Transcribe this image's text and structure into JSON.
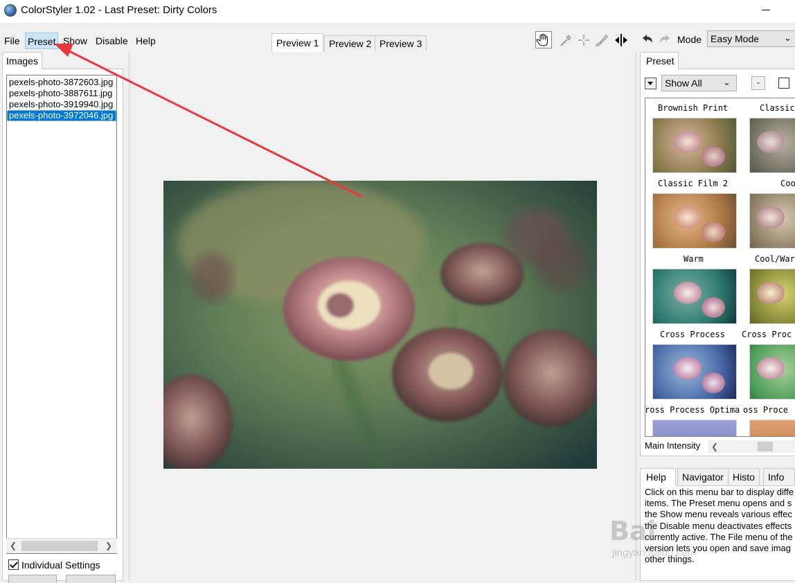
{
  "window": {
    "title": "ColorStyler 1.02 - Last Preset: Dirty Colors"
  },
  "menu": {
    "items": [
      "File",
      "Preset",
      "Show",
      "Disable",
      "Help"
    ]
  },
  "preview_tabs": [
    "Preview 1",
    "Preview 2",
    "Preview 3"
  ],
  "toolbar": {
    "icons": [
      "hand-icon",
      "eyedropper-icon",
      "crosshair-icon",
      "brush-icon",
      "split-view-icon"
    ]
  },
  "mode": {
    "label": "Mode",
    "value": "Easy Mode"
  },
  "images_panel": {
    "tab": "Images",
    "files": [
      "pexels-photo-3872603.jpg",
      "pexels-photo-3887611.jpg",
      "pexels-photo-3919940.jpg",
      "pexels-photo-3972046.jpg"
    ],
    "selected_index": 3,
    "individual_settings_label": "Individual Settings",
    "individual_settings_checked": true
  },
  "preset_panel": {
    "tab": "Preset",
    "filter": "Show All",
    "minus_label": "-",
    "presets": [
      "Brownish Print",
      "Classic",
      "Classic Film 2",
      "Coo",
      "Warm",
      "Cool/War",
      "Cross Process",
      "Cross Proc",
      "ross Process Optima",
      "oss Proce"
    ],
    "intensity_label": "Main Intensity"
  },
  "help_panel": {
    "tabs": [
      "Help",
      "Navigator",
      "Histo",
      "Info"
    ],
    "lines": [
      "Click on this menu bar to display diffe",
      "items. The Preset menu opens and s",
      "the Show menu reveals various effec",
      "the Disable menu deactivates effects",
      "currently active. The File menu of the",
      "version lets you open and save imag",
      "other things."
    ]
  },
  "watermark": {
    "main": "Bai",
    "sub": "jingyan.baidu.com"
  },
  "colors": {
    "selection": "#0078d7",
    "arrow": "#e8383a",
    "menu_highlight": "#cce4f7"
  }
}
